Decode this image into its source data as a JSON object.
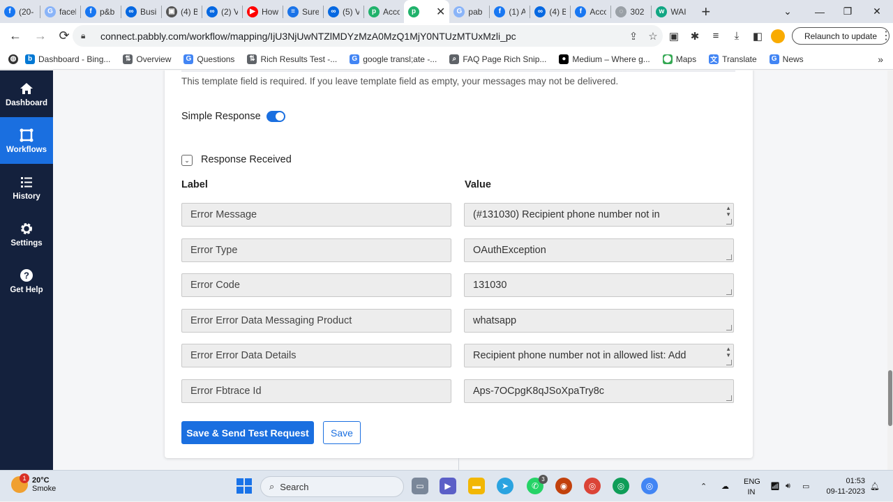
{
  "browser": {
    "tabs": [
      {
        "title": "(20-",
        "icon": "facebook-icon",
        "color": "#1877f2"
      },
      {
        "title": "facel",
        "icon": "google-icon",
        "color": "#8ab4f8"
      },
      {
        "title": "p&b",
        "icon": "facebook-icon",
        "color": "#1877f2"
      },
      {
        "title": "Busi",
        "icon": "meta-icon",
        "color": "#0668e1"
      },
      {
        "title": "(4) B",
        "icon": "page-icon",
        "color": "#555555"
      },
      {
        "title": "(2) V",
        "icon": "meta-icon",
        "color": "#0668e1"
      },
      {
        "title": "How",
        "icon": "youtube-icon",
        "color": "#ff0000"
      },
      {
        "title": "Sure",
        "icon": "list-icon",
        "color": "#1a73e8"
      },
      {
        "title": "(5) V",
        "icon": "meta-icon",
        "color": "#0668e1"
      },
      {
        "title": "Acco",
        "icon": "pabbly-icon",
        "color": "#20b26b"
      },
      {
        "title": "",
        "icon": "pabbly-icon",
        "color": "#20b26b",
        "active": true
      },
      {
        "title": "pab",
        "icon": "google-icon",
        "color": "#8ab4f8"
      },
      {
        "title": "(1) A",
        "icon": "facebook-icon",
        "color": "#1877f2"
      },
      {
        "title": "(4) B",
        "icon": "meta-icon",
        "color": "#0668e1"
      },
      {
        "title": "Acco",
        "icon": "facebook-icon",
        "color": "#1877f2"
      },
      {
        "title": "302",
        "icon": "globe-icon",
        "color": "#9aa0a6"
      },
      {
        "title": "WAI",
        "icon": "wati-icon",
        "color": "#11a683"
      }
    ],
    "url": "connect.pabbly.com/workflow/mapping/IjU3NjUwNTZlMDYzMzA0MzQ1MjY0NTUzMTUxMzli_pc",
    "relaunch_label": "Relaunch to update",
    "bookmarks": [
      {
        "label": "Dashboard - Bing...",
        "icon": "bing-icon",
        "color": "#0078d4"
      },
      {
        "label": "Overview",
        "icon": "overview-icon",
        "color": "#5f6368"
      },
      {
        "label": "Questions",
        "icon": "google-icon",
        "color": "#4285f4"
      },
      {
        "label": "Rich Results Test -...",
        "icon": "rich-results-icon",
        "color": "#5f6368"
      },
      {
        "label": "google transl;ate -...",
        "icon": "google-icon",
        "color": "#4285f4"
      },
      {
        "label": "FAQ Page Rich Snip...",
        "icon": "search-icon",
        "color": "#5f6368"
      },
      {
        "label": "Medium – Where g...",
        "icon": "medium-icon",
        "color": "#000000"
      },
      {
        "label": "Maps",
        "icon": "maps-icon",
        "color": "#34a853"
      },
      {
        "label": "Translate",
        "icon": "translate-icon",
        "color": "#4285f4"
      },
      {
        "label": "News",
        "icon": "news-icon",
        "color": "#4285f4"
      }
    ]
  },
  "sidebar": {
    "items": [
      {
        "label": "Dashboard",
        "icon": "home-icon"
      },
      {
        "label": "Workflows",
        "icon": "workflows-icon",
        "active": true
      },
      {
        "label": "History",
        "icon": "history-icon"
      },
      {
        "label": "Settings",
        "icon": "gear-icon"
      },
      {
        "label": "Get Help",
        "icon": "help-icon"
      }
    ]
  },
  "main": {
    "help_text": "This template field is required. If you leave template field as empty, your messages may not be delivered.",
    "simple_response_label": "Simple Response",
    "simple_response_on": true,
    "response_received_label": "Response Received",
    "label_header": "Label",
    "value_header": "Value",
    "rows": [
      {
        "label": "Error Message",
        "value": "(#131030) Recipient phone number not in",
        "spinner": true
      },
      {
        "label": "Error Type",
        "value": "OAuthException"
      },
      {
        "label": "Error Code",
        "value": "131030"
      },
      {
        "label": "Error Error Data Messaging Product",
        "value": "whatsapp"
      },
      {
        "label": "Error Error Data Details",
        "value": "Recipient phone number not in allowed list: Add",
        "spinner": true
      },
      {
        "label": "Error Fbtrace Id",
        "value": "Aps-7OCpgK8qJSoXpaTry8c"
      }
    ],
    "save_send_label": "Save & Send Test Request",
    "save_label": "Save"
  },
  "taskbar": {
    "temperature": "20°C",
    "weather_text": "Smoke",
    "weather_badge": "1",
    "search_placeholder": "Search",
    "whatsapp_badge": "3",
    "lang_line1": "ENG",
    "lang_line2": "IN",
    "time": "01:53",
    "date": "09-11-2023"
  }
}
